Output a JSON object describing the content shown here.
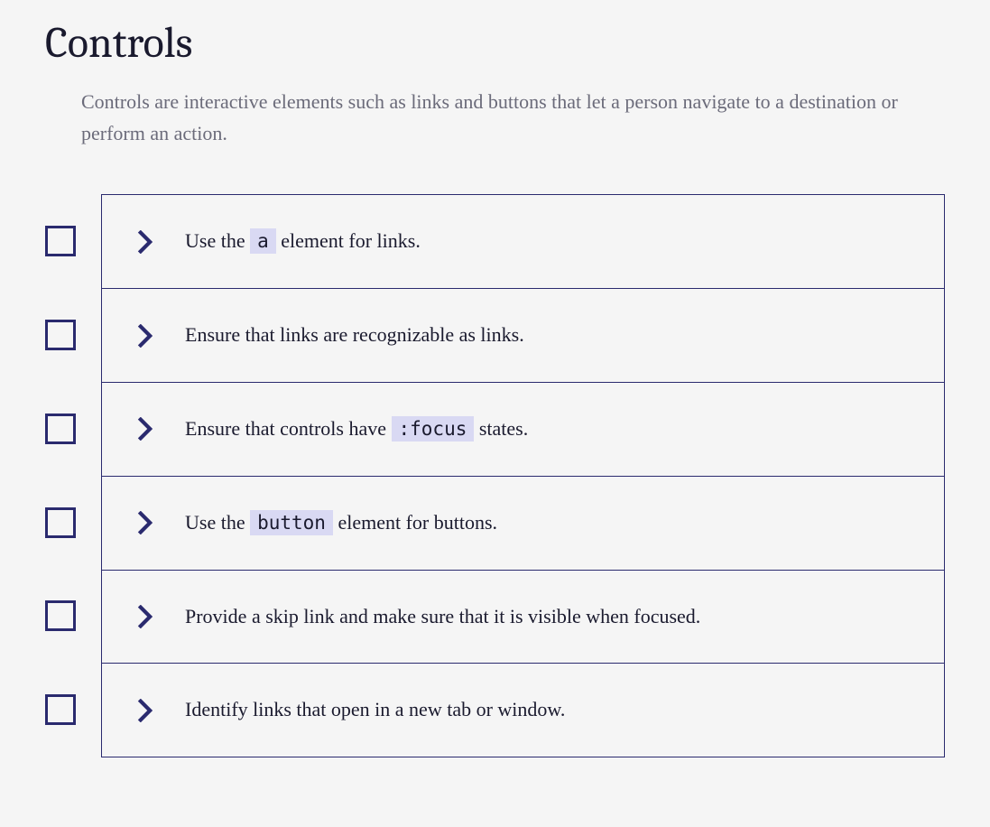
{
  "title": "Controls",
  "description": "Controls are interactive elements such as links and buttons that let a person navigate to a destination or perform an action.",
  "items": [
    {
      "parts": [
        {
          "t": "text",
          "v": "Use the "
        },
        {
          "t": "code",
          "v": "a"
        },
        {
          "t": "text",
          "v": " element for links."
        }
      ]
    },
    {
      "parts": [
        {
          "t": "text",
          "v": "Ensure that links are recognizable as links."
        }
      ]
    },
    {
      "parts": [
        {
          "t": "text",
          "v": "Ensure that controls have "
        },
        {
          "t": "code",
          "v": ":focus"
        },
        {
          "t": "text",
          "v": " states."
        }
      ]
    },
    {
      "parts": [
        {
          "t": "text",
          "v": "Use the "
        },
        {
          "t": "code",
          "v": "button"
        },
        {
          "t": "text",
          "v": " element for buttons."
        }
      ]
    },
    {
      "parts": [
        {
          "t": "text",
          "v": "Provide a skip link and make sure that it is visible when focused."
        }
      ]
    },
    {
      "parts": [
        {
          "t": "text",
          "v": "Identify links that open in a new tab or window."
        }
      ]
    }
  ]
}
